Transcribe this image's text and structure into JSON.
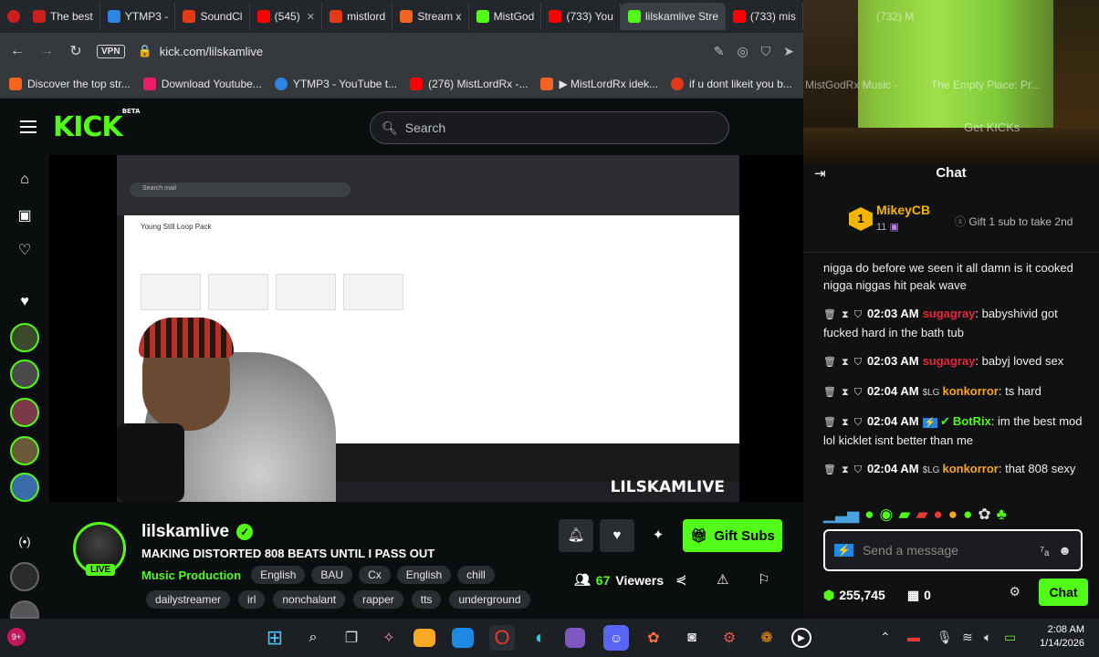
{
  "browser": {
    "tabs": [
      {
        "label": "The best",
        "color": "#cc1f1f"
      },
      {
        "label": "YTMP3 -",
        "color": "#2b87e3"
      },
      {
        "label": "SoundCl",
        "color": "#e53a1a"
      },
      {
        "label": "(545)",
        "color": "#ff0000"
      },
      {
        "label": "mistlord",
        "color": "#e53a1a"
      },
      {
        "label": "Stream x",
        "color": "#f26522"
      },
      {
        "label": "MistGod",
        "color": "#53fc18"
      },
      {
        "label": "(733) You",
        "color": "#ff0000"
      },
      {
        "label": "lilskamlive Stre",
        "color": "#53fc18"
      },
      {
        "label": "(733) mis",
        "color": "#ff0000"
      }
    ],
    "address": {
      "vpn_label": "VPN",
      "url": "kick.com/lilskamlive"
    },
    "bookmarks": [
      {
        "label": "Discover the top str...",
        "color": "#f26522"
      },
      {
        "label": "Download Youtube...",
        "color": "#e91e63"
      },
      {
        "label": "YTMP3 - YouTube t...",
        "color": "#2b87e3"
      },
      {
        "label": "(276) MistLordRx -...",
        "color": "#ff0000"
      },
      {
        "label": "▶ MistLordRx idek...",
        "color": "#f26522"
      },
      {
        "label": "if u dont likeit you b...",
        "color": "#e53a1a"
      }
    ]
  },
  "webcam": {
    "ghost_texts": [
      "MistGodRx Music -",
      "The Empty Place: Pr...",
      "Get KICKs",
      "(732) M"
    ]
  },
  "kick": {
    "logo": "KICK",
    "logo_badge": "BETA",
    "search_placeholder": "Search"
  },
  "video": {
    "watermark": "LILSKAMLIVE",
    "mail_title": "Young Still Loop Pack",
    "mail_search": "Search mail"
  },
  "stream": {
    "channel": "lilskamlive",
    "live_label": "LIVE",
    "title": "MAKING DISTORTED 808 BEATS UNTIL I PASS OUT",
    "category": "Music Production",
    "tags_row1": [
      "English",
      "BAU",
      "Cx",
      "English",
      "chill"
    ],
    "tags_row2": [
      "dailystreamer",
      "irl",
      "nonchalant",
      "rapper",
      "tts",
      "underground"
    ],
    "viewers_count": "67",
    "viewers_label": "Viewers",
    "gift_label": "Gift Subs"
  },
  "chat": {
    "title": "Chat",
    "pinned": {
      "rank": "1",
      "name": "MikeyCB",
      "sub_count": "11",
      "gift_text": "Gift 1 sub to take 2nd"
    },
    "messages": [
      {
        "time": "",
        "user": "",
        "user_color": "#ffffff",
        "text": "nigga do before we seen it all damn is it cooked nigga niggas hit peak wave"
      },
      {
        "time": "02:03 AM",
        "user": "sugagray",
        "user_color": "#e8283a",
        "text": ": babyshivid got fucked hard in the bath tub"
      },
      {
        "time": "02:03 AM",
        "user": "sugagray",
        "user_color": "#e8283a",
        "text": ": babyj loved sex"
      },
      {
        "time": "02:04 AM",
        "user": "konkorror",
        "user_color": "#f5a623",
        "text": ": ts hard"
      },
      {
        "time": "02:04 AM",
        "user": "BotRix",
        "user_color": "#53fc18",
        "text": ": im the best mod lol kicklet isnt better than me"
      },
      {
        "time": "02:04 AM",
        "user": "konkorror",
        "user_color": "#f5a623",
        "text": ": that 808 sexy"
      }
    ],
    "input_placeholder": "Send a message",
    "kicks_balance": "255,745",
    "drops_count": "0",
    "send_label": "Chat"
  },
  "taskbar": {
    "time": "2:08 AM",
    "date": "1/14/2026",
    "discord_badge": "9+"
  }
}
